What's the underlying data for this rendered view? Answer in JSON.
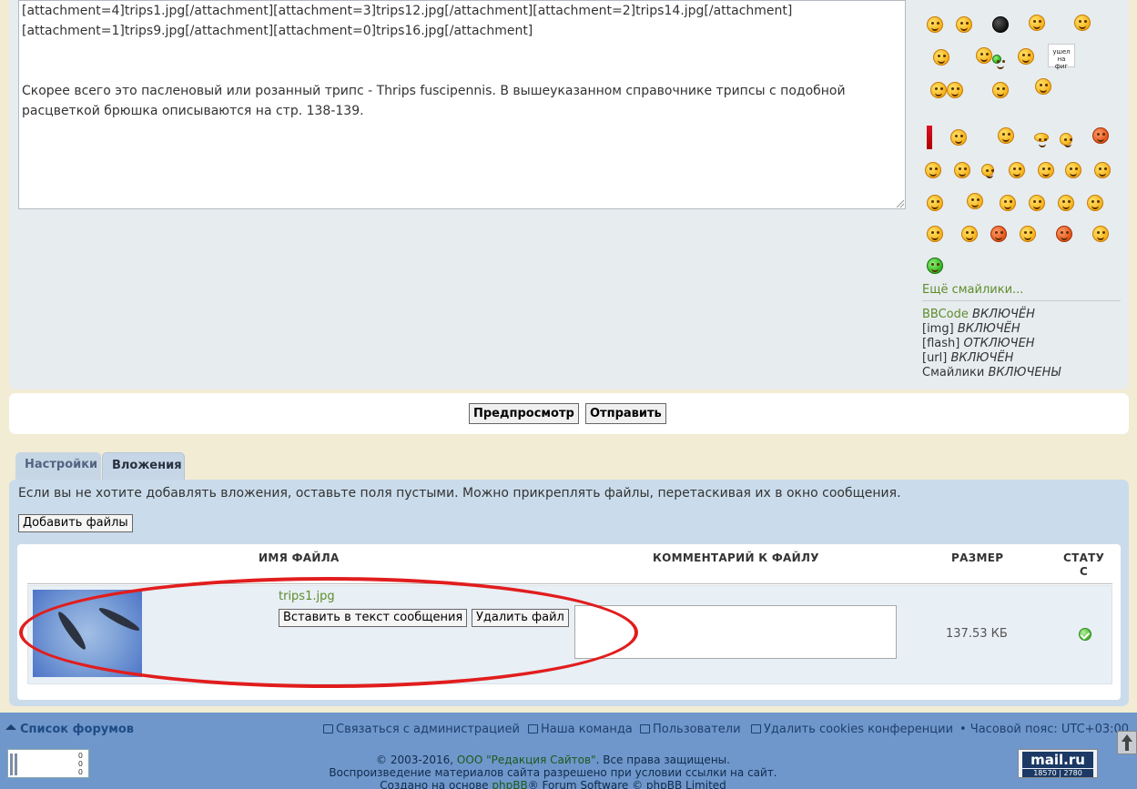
{
  "message": {
    "line1": "[attachment=4]trips1.jpg[/attachment][attachment=3]trips12.jpg[/attachment][attachment=2]trips14.jpg[/attachment]",
    "line2": "[attachment=1]trips9.jpg[/attachment][attachment=0]trips16.jpg[/attachment]",
    "line3": "Скорее всего это пасленовый или розанный трипс - Thrips fuscipennis. В вышеуказанном справочнике трипсы с подобной",
    "line4": "расцветкой брюшка описываются на стр. 138-139."
  },
  "smilies": {
    "more_label": "Ещё смайлики..."
  },
  "bbcodes": {
    "bbcode_name": "BBCode",
    "bbcode_state": "ВКЛЮЧЁН",
    "img_name": "[img]",
    "img_state": "ВКЛЮЧЁН",
    "flash_name": "[flash]",
    "flash_state": "ОТКЛЮЧЕН",
    "url_name": "[url]",
    "url_state": "ВКЛЮЧЁН",
    "smilies_name": "Смайлики",
    "smilies_state": "ВКЛЮЧЕНЫ"
  },
  "submit": {
    "preview_label": "Предпросмотр",
    "send_label": "Отправить"
  },
  "tabs": [
    {
      "label": "Настройки"
    },
    {
      "label": "Вложения"
    }
  ],
  "attachments": {
    "note": "Если вы не хотите добавлять вложения, оставьте поля пустыми. Можно прикреплять файлы, перетаскивая их в окно сообщения.",
    "add_files_label": "Добавить файлы",
    "headers": {
      "filename": "ИМЯ ФАЙЛА",
      "comment": "КОММЕНТАРИЙ К ФАЙЛУ",
      "size": "РАЗМЕР",
      "status_line1": "СТАТУ",
      "status_line2": "С"
    },
    "file": {
      "name": "trips1.jpg",
      "insert_label": "Вставить в текст сообщения",
      "delete_label": "Удалить файл",
      "comment_value": "",
      "size": "137.53 КБ"
    }
  },
  "footer": {
    "forums_list": "Список форумов",
    "contact_admin": "Связаться с администрацией",
    "our_team": "Наша команда",
    "users": "Пользователи",
    "delete_cookies": "Удалить cookies конференции",
    "timezone": "• Часовой пояс: UTC+03:00",
    "copyright_prefix": "© 2003-2016,",
    "copyright_company": "ООО \"Редакция Сайтов\"",
    "copyright_suffix": ". Все права защищены.",
    "reproduction": "Воспроизведение материалов сайта разрешено при условии ссылки на сайт.",
    "powered_prefix": "Создано на основе",
    "powered_link": "phpBB",
    "powered_suffix": "® Forum Software © phpBB Limited",
    "mailru_logo": "mail.ru",
    "mailru_count1": "18570",
    "mailru_count2": "2780",
    "counter_left_line1": "0",
    "counter_left_line2": "0",
    "counter_left_line3": "0"
  },
  "colors": {
    "page_bg": "#f2ecd4",
    "panel_bg": "#e7ecef",
    "attach_bg": "#cadceb",
    "footer_bg": "#6f97cb",
    "link_green": "#5f8c2b",
    "highlight_red": "#e11d1d"
  }
}
